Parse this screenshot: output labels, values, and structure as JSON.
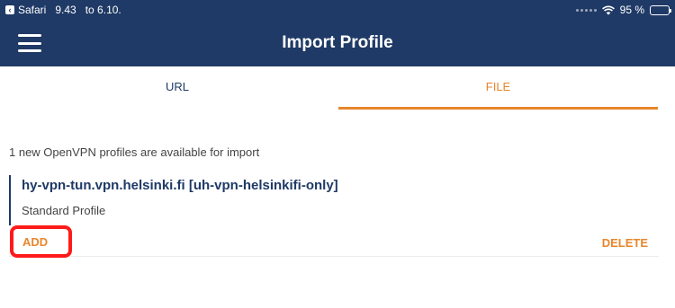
{
  "status_bar": {
    "back_app": "Safari",
    "time": "9.43",
    "date": "to 6.10.",
    "battery_percent_text": "95 %",
    "battery_level": 0.95,
    "icons": [
      "back-arrow-icon",
      "signal-dots-icon",
      "wifi-icon",
      "battery-icon"
    ]
  },
  "header": {
    "title": "Import Profile",
    "menu_icon": "hamburger-menu-icon",
    "background_color": "#1f3a66"
  },
  "tabs": [
    {
      "label": "URL",
      "selected": false
    },
    {
      "label": "FILE",
      "selected": true
    }
  ],
  "info_text": "1 new OpenVPN profiles are available for import",
  "profile": {
    "name": "hy-vpn-tun.vpn.helsinki.fi [uh-vpn-helsinkifi-only]",
    "type": "Standard Profile",
    "add_label": "ADD",
    "delete_label": "DELETE"
  },
  "colors": {
    "accent": "#e8862c",
    "primary": "#1f3a66",
    "highlight": "#ff1a1a"
  }
}
